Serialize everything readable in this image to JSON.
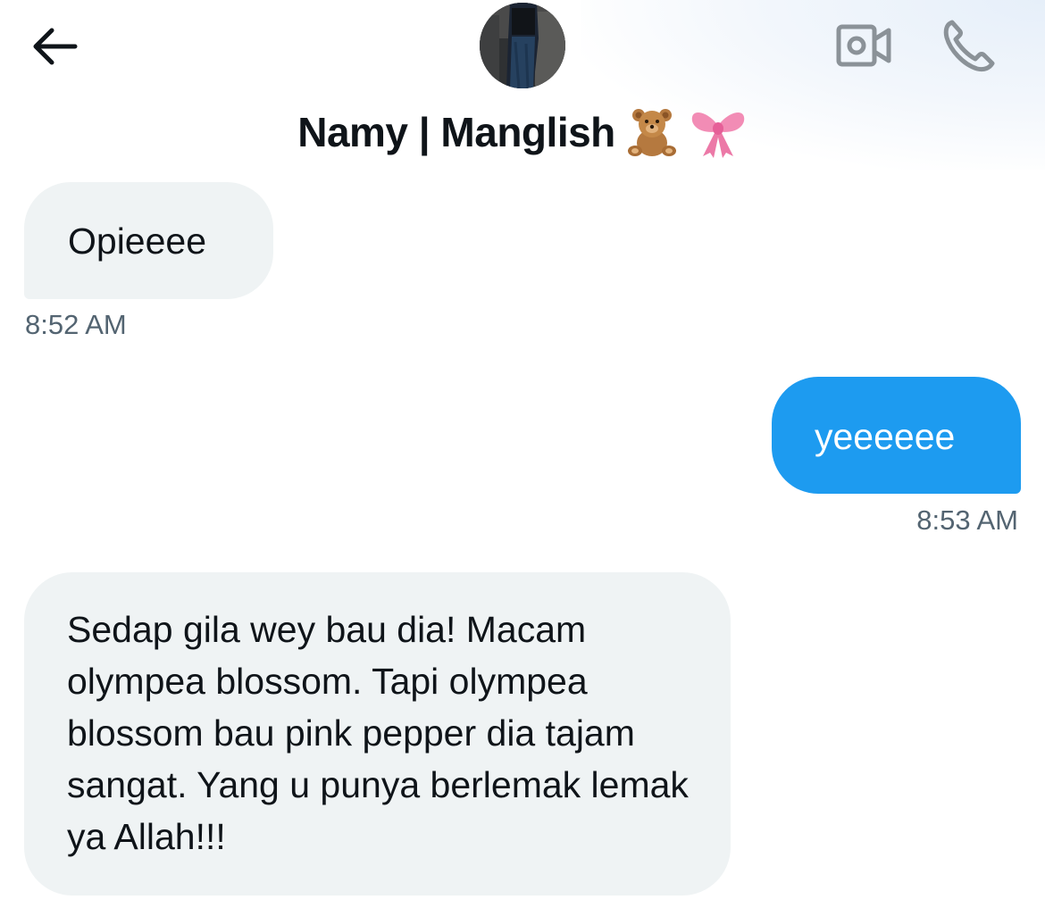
{
  "header": {
    "back_icon": "arrow-left-icon",
    "video_icon": "video-camera-icon",
    "call_icon": "phone-icon",
    "contact_name": "Namy | Manglish",
    "name_emoji": [
      "teddy-bear-emoji",
      "pink-ribbon-emoji"
    ]
  },
  "messages": [
    {
      "direction": "incoming",
      "text": "Opieeee",
      "time": "8:52 AM"
    },
    {
      "direction": "outgoing",
      "text": "yeeeeee",
      "time": "8:53 AM"
    },
    {
      "direction": "incoming",
      "text": "Sedap gila wey bau dia! Macam olympea blossom. Tapi olympea blossom bau pink pepper dia tajam sangat. Yang u punya berlemak lemak ya Allah!!!",
      "time": ""
    }
  ],
  "colors": {
    "incoming_bubble": "#eff3f4",
    "outgoing_bubble": "#1d9bf0",
    "timestamp": "#536471",
    "icon_gray": "#8b9298",
    "text": "#0f1419"
  }
}
